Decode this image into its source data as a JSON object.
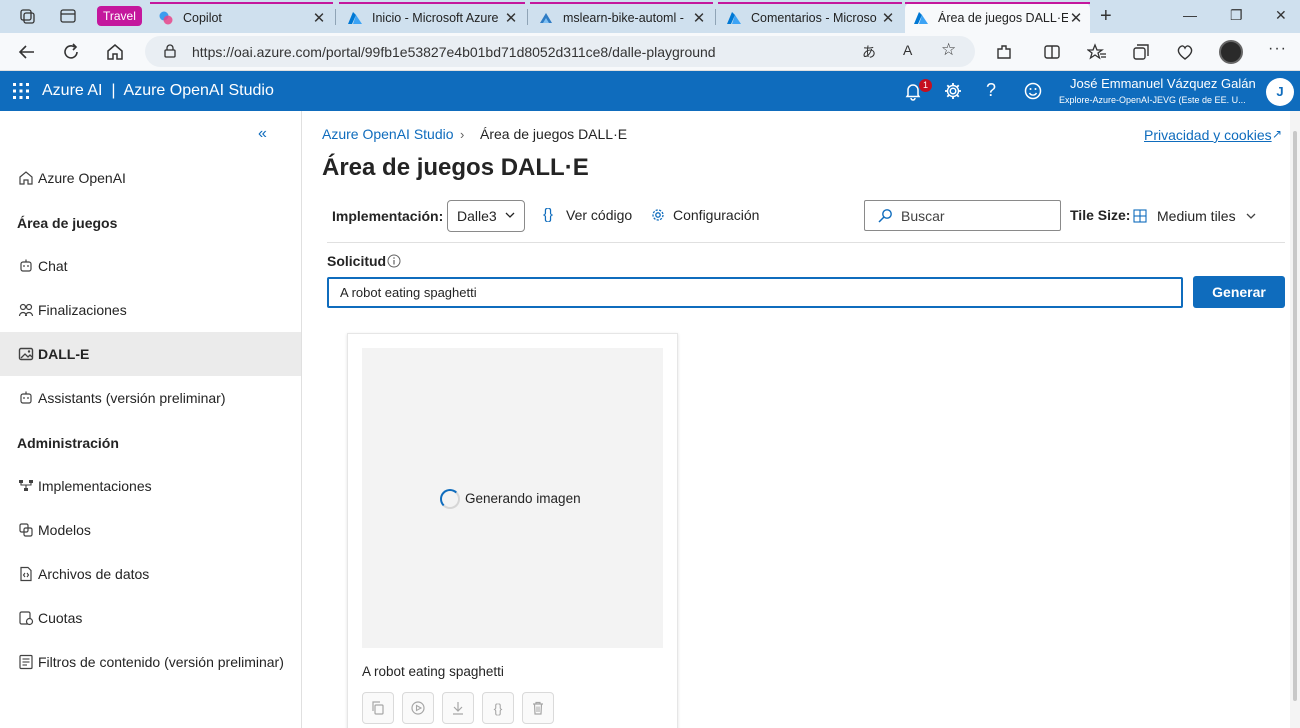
{
  "browser": {
    "tab_group_label": "Travel",
    "tabs": [
      {
        "title": "Copilot",
        "icon": "copilot-icon"
      },
      {
        "title": "Inicio - Microsoft Azure",
        "icon": "azure-icon"
      },
      {
        "title": "mslearn-bike-automl - ",
        "icon": "ml-icon"
      },
      {
        "title": "Comentarios - Microso",
        "icon": "azure-icon"
      },
      {
        "title": "Área de juegos DALL·E",
        "icon": "azure-icon",
        "active": true
      }
    ],
    "url": "https://oai.azure.com/portal/99fb1e53827e4b01bd71d8052d311ce8/dalle-playground"
  },
  "header": {
    "brand": "Azure AI  |  Azure OpenAI Studio",
    "notification_count": "1",
    "user_name": "José Emmanuel Vázquez Galán",
    "user_subtitle": "Explore-Azure-OpenAI-JEVG (Este de EE. U...",
    "avatar_initial": "J"
  },
  "sidebar": {
    "items": [
      {
        "label": "Azure OpenAI",
        "icon": "home-icon"
      },
      {
        "label": "Chat",
        "icon": "chat-icon"
      },
      {
        "label": "Finalizaciones",
        "icon": "completions-icon"
      },
      {
        "label": "DALL-E",
        "icon": "image-icon",
        "active": true
      },
      {
        "label": "Assistants (versión preliminar)",
        "icon": "assistants-icon"
      },
      {
        "label": "Implementaciones",
        "icon": "deployments-icon"
      },
      {
        "label": "Modelos",
        "icon": "models-icon"
      },
      {
        "label": "Archivos de datos",
        "icon": "data-files-icon"
      },
      {
        "label": "Cuotas",
        "icon": "quotas-icon"
      },
      {
        "label": "Filtros de contenido (versión preliminar)",
        "icon": "content-filter-icon"
      }
    ],
    "sections": [
      "Área de juegos",
      "Administración"
    ]
  },
  "main": {
    "breadcrumb_root": "Azure OpenAI Studio",
    "breadcrumb_current": "Área de juegos DALL·E",
    "privacy_link": "Privacidad y cookies",
    "title": "Área de juegos DALL·E",
    "deployment_label": "Implementación:",
    "deployment_value": "Dalle3",
    "view_code": "Ver código",
    "settings": "Configuración",
    "search_placeholder": "Buscar",
    "tile_size_label": "Tile Size:",
    "tile_size_value": "Medium tiles",
    "prompt_label": "Solicitud",
    "prompt_value": "A robot eating spaghetti",
    "generate_button": "Generar",
    "card": {
      "status": "Generando imagen",
      "caption": "A robot eating spaghetti"
    }
  },
  "colors": {
    "accent": "#0f6cbd",
    "tab_group": "#c4179d",
    "notification": "#c50f1f"
  }
}
